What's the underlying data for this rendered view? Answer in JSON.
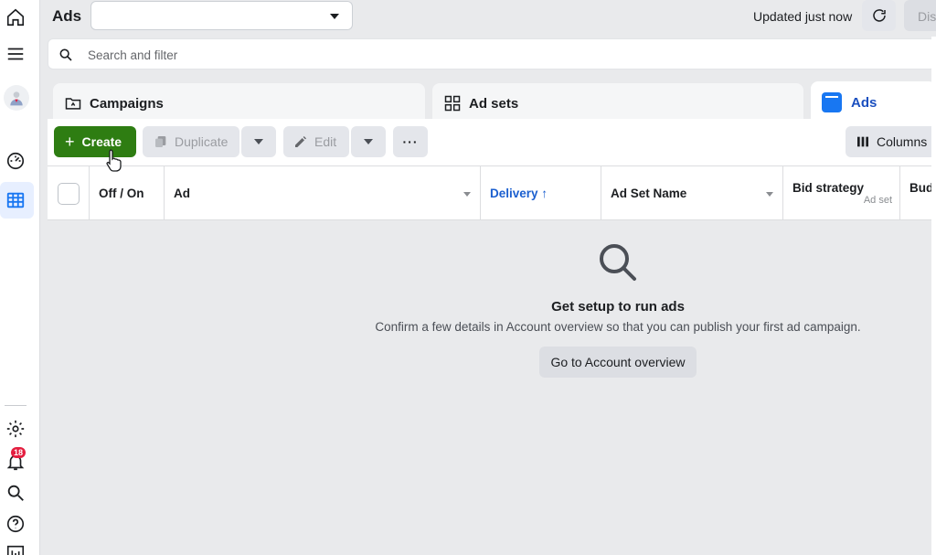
{
  "header": {
    "title": "Ads",
    "account_selector_value": "",
    "updated_text": "Updated just now",
    "discard_label": "Dis"
  },
  "search": {
    "placeholder": "Search and filter"
  },
  "sidebar": {
    "notifications_count": "18",
    "icons": [
      "home-icon",
      "menu-icon",
      "avatar",
      "dashboard-gauge-icon",
      "ads-manager-grid-icon",
      "settings-gear-icon",
      "notifications-bell-icon",
      "search-icon",
      "help-icon",
      "reports-icon"
    ]
  },
  "tabs": [
    {
      "label": "Campaigns",
      "icon": "folder-icon"
    },
    {
      "label": "Ad sets",
      "icon": "grid-icon"
    },
    {
      "label": "Ads",
      "icon": "ad-square-icon",
      "active": true
    }
  ],
  "toolbar": {
    "create_label": "Create",
    "duplicate_label": "Duplicate",
    "edit_label": "Edit",
    "more_label": "···",
    "columns_label": "Columns"
  },
  "table": {
    "columns": [
      {
        "label": "Off / On"
      },
      {
        "label": "Ad"
      },
      {
        "label": "Delivery ↑"
      },
      {
        "label": "Ad Set Name"
      },
      {
        "label": "Bid strategy",
        "sub": "Ad set"
      },
      {
        "label": "Budg"
      }
    ]
  },
  "empty_state": {
    "title": "Get setup to run ads",
    "description": "Confirm a few details in Account overview so that you can publish your first ad campaign.",
    "button_label": "Go to Account overview"
  },
  "colors": {
    "create_green": "#2e7d12",
    "accent_blue": "#1877f2",
    "badge_red": "#e41e3f"
  }
}
